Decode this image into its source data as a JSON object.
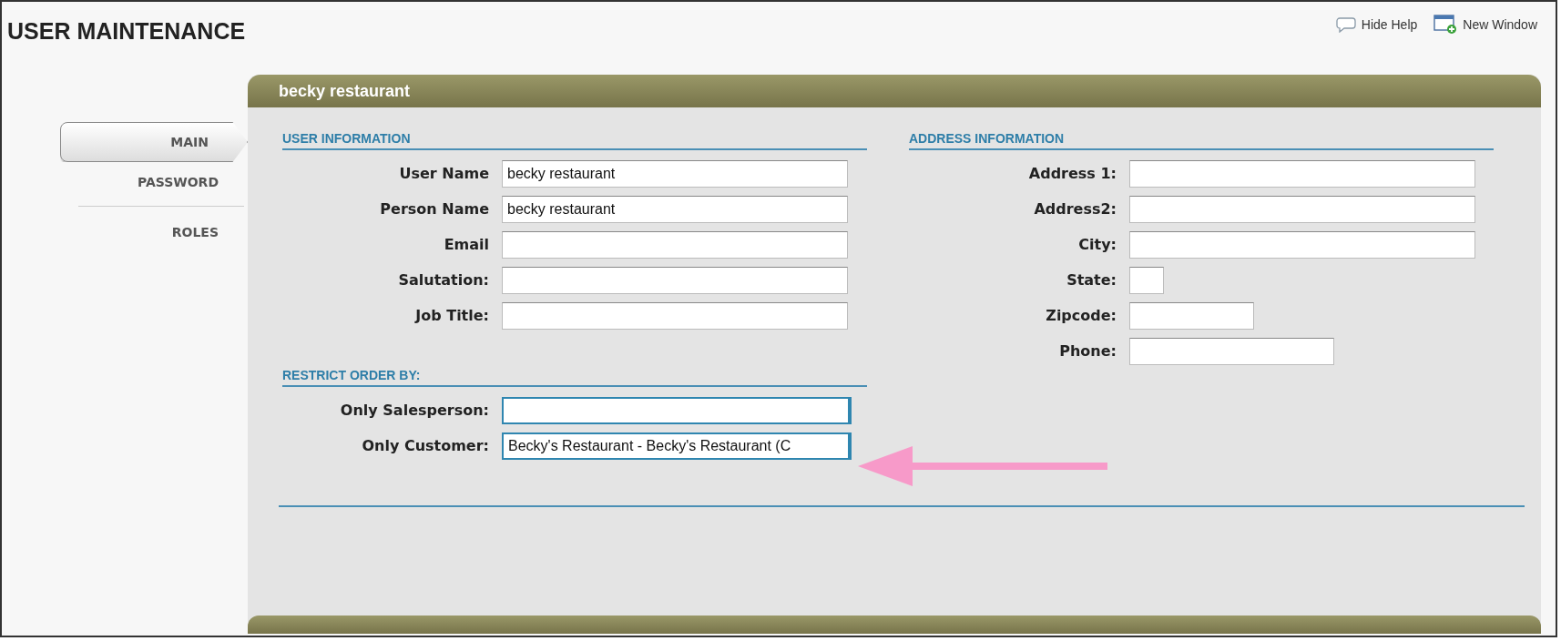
{
  "page": {
    "title": "USER MAINTENANCE"
  },
  "toolbar": [
    {
      "label": "Hide Help",
      "kind": "help"
    },
    {
      "label": "New Window",
      "kind": "window"
    }
  ],
  "panel": {
    "title": "becky restaurant"
  },
  "tabs": [
    {
      "label": "MAIN",
      "selected": true
    },
    {
      "label": "PASSWORD",
      "selected": false
    },
    {
      "label": "ROLES",
      "selected": false
    }
  ],
  "user_information": {
    "heading": "USER INFORMATION",
    "fields": [
      {
        "label": "User Name",
        "value": "becky restaurant",
        "kind": "wide"
      },
      {
        "label": "Person Name",
        "value": "becky restaurant",
        "kind": "wide"
      },
      {
        "label": "Email",
        "kind": "wide"
      },
      {
        "label": "Salutation:",
        "kind": "wide"
      },
      {
        "label": "Job Title:",
        "kind": "wide"
      }
    ]
  },
  "restrict_order_by": {
    "heading": "RESTRICT ORDER BY:",
    "fields": [
      {
        "label": "Only Salesperson:",
        "kind": "lookup"
      },
      {
        "label": "Only Customer:",
        "value": "Becky's Restaurant - Becky's Restaurant (C",
        "kind": "lookup"
      }
    ]
  },
  "address_information": {
    "heading": "ADDRESS INFORMATION",
    "fields": [
      {
        "label": "Address 1:",
        "kind": "wide"
      },
      {
        "label": "Address2:",
        "kind": "wide"
      },
      {
        "label": "City:",
        "kind": "wide"
      },
      {
        "label": "State:",
        "kind": "tiny"
      },
      {
        "label": "Zipcode:",
        "kind": "small"
      },
      {
        "label": "Phone:",
        "kind": "medium"
      }
    ]
  }
}
